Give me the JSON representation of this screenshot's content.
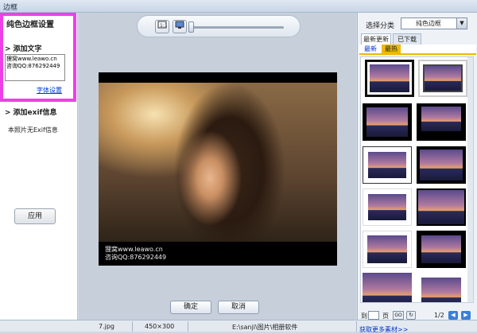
{
  "window": {
    "title": "边框"
  },
  "left_panel": {
    "title": "纯色边框设置",
    "add_text_label": "添加文字",
    "text_value": "狸窝www.leawo.cn\n咨询QQ:876292449",
    "font_settings_link": "字体设置",
    "add_exif_label": "添加exif信息",
    "no_exif_text": "本照片无Exif信息",
    "apply_button": "应用",
    "highlight_color": "#ef3fe8"
  },
  "center": {
    "watermark_line1": "狸窝www.leawo.cn",
    "watermark_line2": "咨询QQ:876292449",
    "ok_button": "确定",
    "cancel_button": "取消",
    "toolbar_icons": [
      "fit-screen-icon",
      "monitor-icon"
    ]
  },
  "right_panel": {
    "category_label": "选择分类",
    "category_value": "纯色边框",
    "tabs": [
      "最新更新",
      "已下载"
    ],
    "subtabs": [
      "最新",
      "最热"
    ],
    "pager_label": "到",
    "pager_unit": "页",
    "go_label": "GO",
    "page_indicator": "1/2",
    "more_link": "获取更多素材>>"
  },
  "status_bar": {
    "filename": "7.jpg",
    "dimensions": "450×300",
    "path": "E:\\sanji\\图片\\相册软件"
  }
}
